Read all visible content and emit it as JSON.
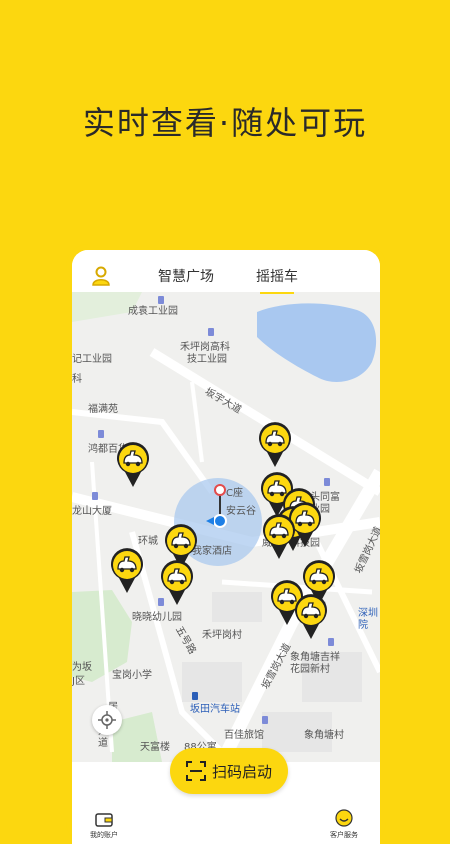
{
  "headline": "实时查看·随处可玩",
  "tabs": [
    {
      "label": "智慧广场",
      "active": false
    },
    {
      "label": "摇摇车",
      "active": true
    }
  ],
  "map_labels": {
    "chengyuan": "成袁工业园",
    "gongyeyuan_left": "记工业园",
    "kejiyuan": "禾坪岗高科",
    "kejiyuan2": "技工业园",
    "ke": "科",
    "fumanyuan": "福满苑",
    "bantian_road": "坂宇大道",
    "hongdu": "鸿都百货",
    "longshan": "龙山大厦",
    "huancheng": "环城",
    "anyun": "安云谷",
    "c_zuo": "C座",
    "hotel": "我家酒店",
    "gangtou": "岗头同富",
    "gangtou2": "工业园",
    "keji_park": "科技园",
    "wei": "威",
    "jianyu": "健园",
    "xiaoxiao": "晓晓幼儿园",
    "wuhao": "五号路",
    "hepinggangcun": "禾坪岗村",
    "bantian_main": "坂雪岗大道",
    "xiangjiao": "象角塘吉祥",
    "xiangjiao2": "花园新村",
    "weiban": "为坂",
    "jqu": "J区",
    "baogang": "宝岗小学",
    "ju": "居",
    "bus_station": "坂田汽车站",
    "baijia": "百佳旅馆",
    "xiangjiaocun": "象角塘村",
    "tianfu": "天富楼",
    "guangyu": "88公寓",
    "bantian_right": "坂雪岗大道",
    "shenzhen": "深圳",
    "yuan": "院",
    "da": "大",
    "dao": "道"
  },
  "scan_button": "扫码启动",
  "bottom_nav": {
    "account": "我的账户",
    "service": "客户服务"
  },
  "colors": {
    "brand_yellow": "#FCD70F",
    "map_water": "#a9c8f0",
    "map_green": "#d7ebcf",
    "location_blue": "#1d7fe6"
  },
  "icons": {
    "avatar": "user-icon",
    "locate": "crosshair-icon",
    "scan": "scan-icon",
    "wallet": "wallet-icon",
    "service": "smile-icon",
    "marker": "ride-car-icon"
  }
}
